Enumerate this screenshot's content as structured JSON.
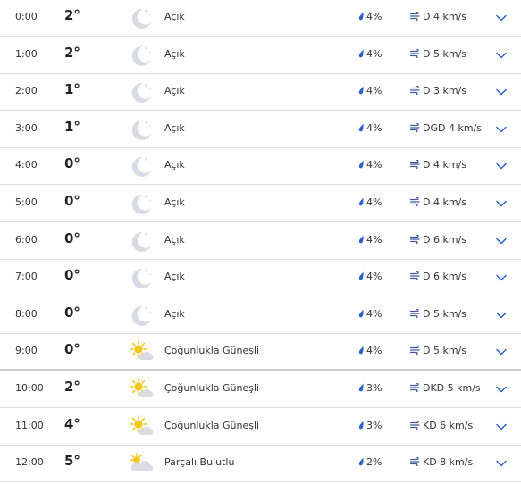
{
  "colors": {
    "accent": "#2a62c9",
    "moon": "#d8dbe3",
    "sun": "#f5c518",
    "cloud": "#d9dde3",
    "divider": "#dddddd"
  },
  "icons": {
    "clear_night": "moon-icon",
    "mostly_sunny": "sun-cloud-icon",
    "partly_cloudy": "partly-cloudy-icon",
    "precip": "raindrop-icon",
    "wind": "wind-icon",
    "expand": "chevron-down-icon"
  },
  "rows": [
    {
      "time": "0:00",
      "temp": "2°",
      "icon": "moon",
      "condition": "Açık",
      "precip": "4%",
      "wind": "D 4 km/s"
    },
    {
      "time": "1:00",
      "temp": "2°",
      "icon": "moon",
      "condition": "Açık",
      "precip": "4%",
      "wind": "D 5 km/s"
    },
    {
      "time": "2:00",
      "temp": "1°",
      "icon": "moon",
      "condition": "Açık",
      "precip": "4%",
      "wind": "D 3 km/s"
    },
    {
      "time": "3:00",
      "temp": "1°",
      "icon": "moon",
      "condition": "Açık",
      "precip": "4%",
      "wind": "DGD 4 km/s"
    },
    {
      "time": "4:00",
      "temp": "0°",
      "icon": "moon",
      "condition": "Açık",
      "precip": "4%",
      "wind": "D 4 km/s"
    },
    {
      "time": "5:00",
      "temp": "0°",
      "icon": "moon",
      "condition": "Açık",
      "precip": "4%",
      "wind": "D 4 km/s"
    },
    {
      "time": "6:00",
      "temp": "0°",
      "icon": "moon",
      "condition": "Açık",
      "precip": "4%",
      "wind": "D 6 km/s"
    },
    {
      "time": "7:00",
      "temp": "0°",
      "icon": "moon",
      "condition": "Açık",
      "precip": "4%",
      "wind": "D 6 km/s"
    },
    {
      "time": "8:00",
      "temp": "0°",
      "icon": "moon",
      "condition": "Açık",
      "precip": "4%",
      "wind": "D 5 km/s"
    },
    {
      "time": "9:00",
      "temp": "0°",
      "icon": "sun-cloud",
      "condition": "Çoğunlukla Güneşli",
      "precip": "4%",
      "wind": "D 5 km/s"
    },
    {
      "time": "10:00",
      "temp": "2°",
      "icon": "sun-cloud",
      "condition": "Çoğunlukla Güneşli",
      "precip": "3%",
      "wind": "DKD 5 km/s"
    },
    {
      "time": "11:00",
      "temp": "4°",
      "icon": "sun-cloud",
      "condition": "Çoğunlukla Güneşli",
      "precip": "3%",
      "wind": "KD 6 km/s"
    },
    {
      "time": "12:00",
      "temp": "5°",
      "icon": "partly-cloudy",
      "condition": "Parçalı Bulutlu",
      "precip": "2%",
      "wind": "KD 8 km/s"
    }
  ]
}
